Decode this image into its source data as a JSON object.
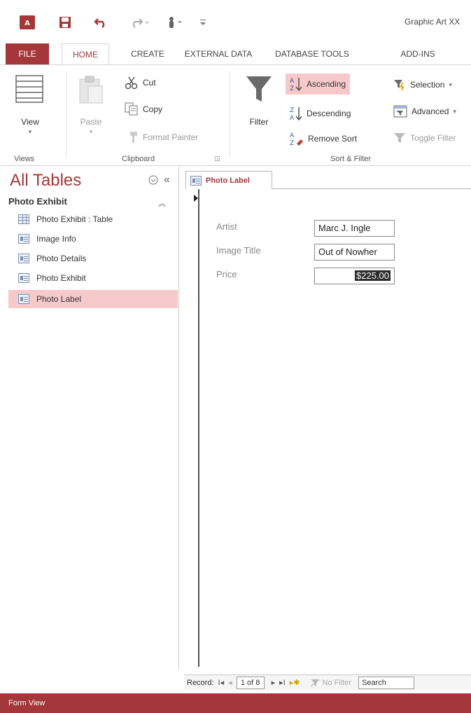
{
  "app": {
    "title": "Graphic Art XX"
  },
  "tabs": [
    "FILE",
    "HOME",
    "CREATE",
    "EXTERNAL DATA",
    "DATABASE TOOLS",
    "ADD-INS"
  ],
  "ribbon": {
    "views": {
      "view_label": "View",
      "group": "Views"
    },
    "clipboard": {
      "paste_label": "Paste",
      "cut_label": "Cut",
      "copy_label": "Copy",
      "format_painter_label": "Format Painter",
      "group": "Clipboard"
    },
    "sort_filter": {
      "filter_label": "Filter",
      "ascending_label": "Ascending",
      "descending_label": "Descending",
      "remove_sort_label": "Remove Sort",
      "selection_label": "Selection",
      "advanced_label": "Advanced",
      "toggle_filter_label": "Toggle Filter",
      "group": "Sort & Filter"
    }
  },
  "nav": {
    "title": "All Tables",
    "group": "Photo Exhibit",
    "items": [
      {
        "label": "Photo Exhibit : Table",
        "kind": "table"
      },
      {
        "label": "Image Info",
        "kind": "form"
      },
      {
        "label": "Photo Details",
        "kind": "form"
      },
      {
        "label": "Photo Exhibit",
        "kind": "form"
      },
      {
        "label": "Photo Label",
        "kind": "form",
        "selected": true
      }
    ]
  },
  "document": {
    "tab_label": "Photo Label",
    "fields": [
      {
        "label": "Artist",
        "value": "Marc J. Ingle"
      },
      {
        "label": "Image Title",
        "value": "Out of Nowher"
      },
      {
        "label": "Price",
        "value": "$225.00"
      }
    ]
  },
  "record_nav": {
    "label": "Record:",
    "position": "1 of 8",
    "filter_label": "No Filter",
    "search_label": "Search"
  },
  "status": {
    "text": "Form View"
  },
  "colors": {
    "accent": "#a4373a",
    "highlight": "#f7c9cb"
  }
}
